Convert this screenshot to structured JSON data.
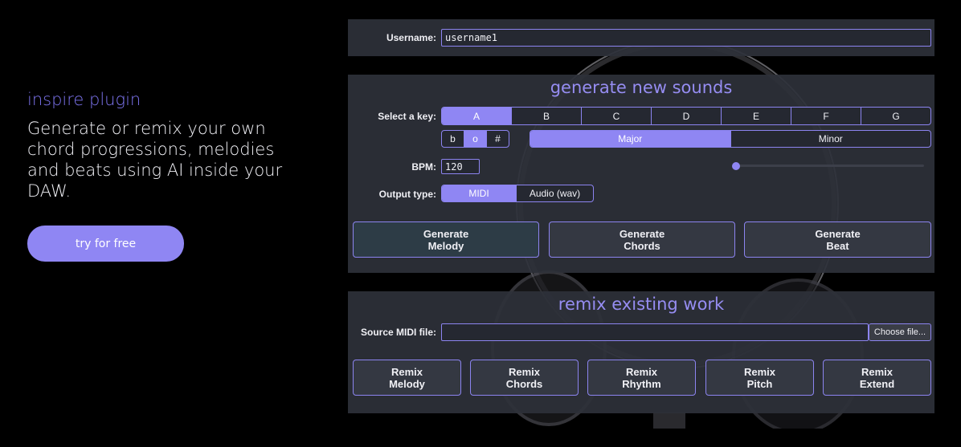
{
  "hero": {
    "kicker": "inspire plugin",
    "text": "Generate or remix your own chord progressions, melodies and beats using AI inside your DAW.",
    "cta": "try for free"
  },
  "plugin": {
    "username_label": "Username:",
    "username_value": "username1",
    "generate_title": "generate new sounds",
    "key_label": "Select a key:",
    "keys": [
      "A",
      "B",
      "C",
      "D",
      "E",
      "F",
      "G"
    ],
    "selected_key": "A",
    "accidentals": [
      "b",
      "o",
      "#"
    ],
    "selected_accidental": "o",
    "modes": [
      "Major",
      "Minor"
    ],
    "selected_mode": "Major",
    "bpm_label": "BPM:",
    "bpm_value": "120",
    "output_label": "Output type:",
    "outputs": [
      "MIDI",
      "Audio (wav)"
    ],
    "selected_output": "MIDI",
    "generate_buttons": [
      {
        "line1": "Generate",
        "line2": "Melody"
      },
      {
        "line1": "Generate",
        "line2": "Chords"
      },
      {
        "line1": "Generate",
        "line2": "Beat"
      }
    ],
    "remix_title": "remix existing work",
    "source_label": "Source MIDI file:",
    "source_value": "",
    "choose_file": "Choose file...",
    "remix_buttons": [
      {
        "line1": "Remix",
        "line2": "Melody"
      },
      {
        "line1": "Remix",
        "line2": "Chords"
      },
      {
        "line1": "Remix",
        "line2": "Rhythm"
      },
      {
        "line1": "Remix",
        "line2": "Pitch"
      },
      {
        "line1": "Remix",
        "line2": "Extend"
      }
    ]
  },
  "colors": {
    "accent": "#8f86f3",
    "panel": "#2e313a",
    "field": "#252831",
    "button": "#2d3c46",
    "page_bg": "#000000"
  }
}
